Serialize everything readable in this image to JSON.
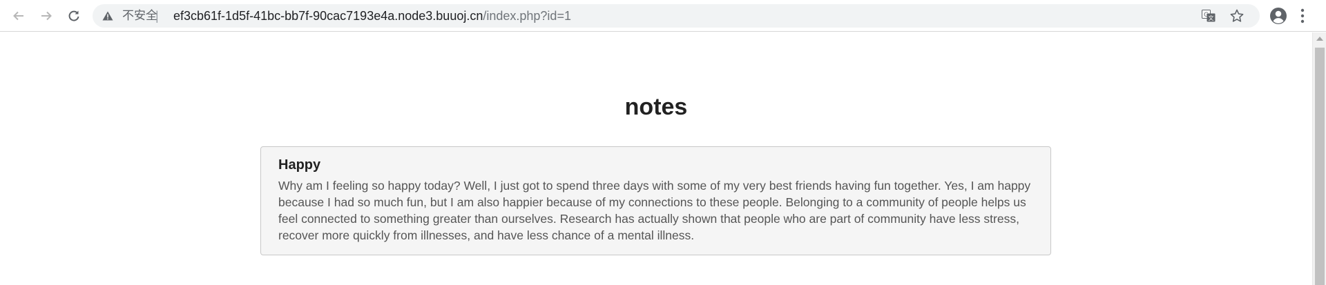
{
  "browser": {
    "security_label": "不安全",
    "separator": "|",
    "url_host": "ef3cb61f-1d5f-41bc-bb7f-90cac7193e4a.node3.buuoj.cn",
    "url_path": "/index.php?id=1"
  },
  "page": {
    "title": "notes",
    "note": {
      "title": "Happy",
      "body": "Why am I feeling so happy today? Well, I just got to spend three days with some of my very best friends having fun together. Yes, I am happy because I had so much fun, but I am also happier because of my connections to these people. Belonging to a community of people helps us feel connected to something greater than ourselves. Research has actually shown that people who are part of community have less stress, recover more quickly from illnesses, and have less chance of a mental illness."
    }
  },
  "icons": {
    "back": "arrow-left-icon",
    "forward": "arrow-right-icon",
    "reload": "reload-icon",
    "warning": "warning-triangle-icon",
    "translate": "translate-icon",
    "bookmark": "star-icon",
    "profile": "account-circle-icon",
    "menu": "vertical-dots-icon"
  },
  "colors": {
    "omnibox_bg": "#f1f3f4",
    "card_bg": "#f5f5f5",
    "card_border": "#c8c8c8",
    "title_text": "#222222",
    "body_text": "#555555"
  }
}
